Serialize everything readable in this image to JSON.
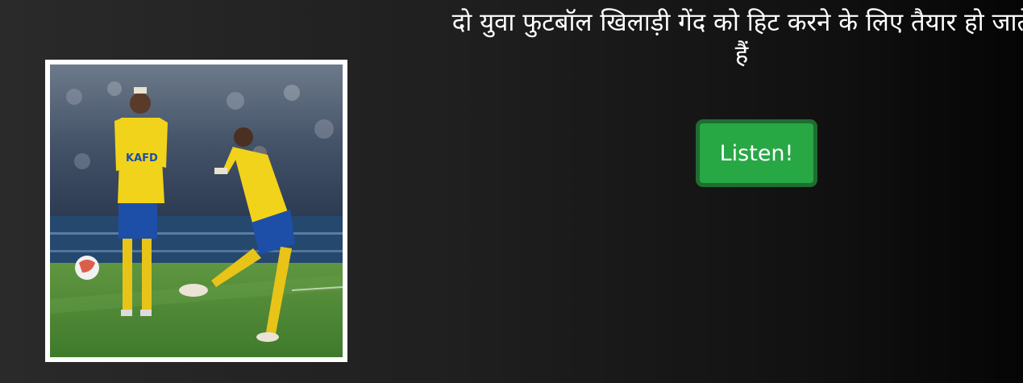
{
  "caption": "दो युवा फुटबॉल खिलाड़ी गेंद को हिट करने के लिए तैयार हो जाते हैं",
  "listen_button": {
    "label": "Listen!"
  },
  "photo": {
    "subject": "two footballers in yellow jerseys, one kicking the ball",
    "shirt_text": "KAFD"
  },
  "colors": {
    "button_fill": "#28a745",
    "button_border": "#1e6e31",
    "text": "#ffffff",
    "jersey_yellow": "#f2d31b",
    "shorts_blue": "#1d4fa8",
    "pitch_green": "#4f8a36"
  }
}
